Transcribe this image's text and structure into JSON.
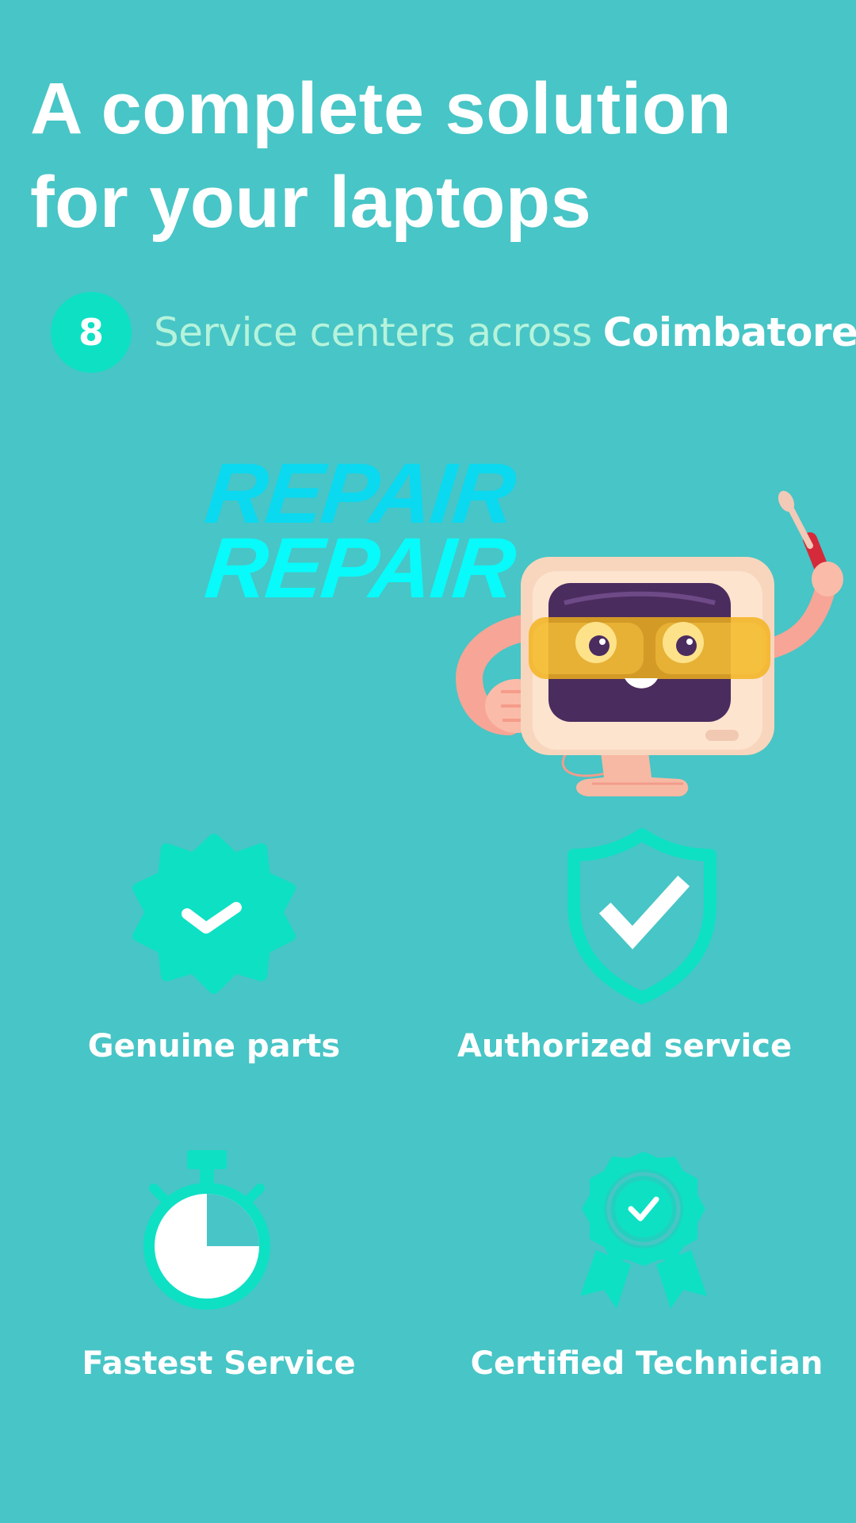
{
  "headline": {
    "line1": "A complete solution",
    "line2": "for your laptops"
  },
  "service_centers": {
    "count": "8",
    "text": "Service centers across",
    "city": "Coimbatore"
  },
  "hero": {
    "word1": "REPAIR",
    "word2": "REPAIR"
  },
  "features": [
    {
      "label": "Genuine parts",
      "icon": "badge-check-icon"
    },
    {
      "label": "Authorized service",
      "icon": "shield-check-icon"
    },
    {
      "label": "Fastest Service",
      "icon": "stopwatch-icon"
    },
    {
      "label": "Certified Technician",
      "icon": "award-ribbon-icon"
    }
  ],
  "colors": {
    "background": "#48c5c6",
    "accent": "#0ee0c4",
    "subtext": "#b6f3dc"
  }
}
